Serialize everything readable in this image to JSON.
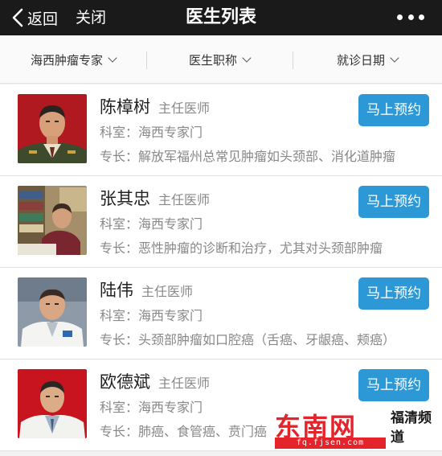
{
  "nav": {
    "back_label": "返回",
    "close_label": "关闭",
    "title": "医生列表"
  },
  "filters": [
    {
      "label": "海西肿瘤专家"
    },
    {
      "label": "医生职称"
    },
    {
      "label": "就诊日期"
    }
  ],
  "doctors": [
    {
      "name": "陈樟树",
      "title": "主任医师",
      "department": "科室：海西专家门",
      "specialty": "专长：解放军福州总常见肿瘤如头颈部、消化道肿瘤",
      "book_label": "马上预约"
    },
    {
      "name": "张其忠",
      "title": "主任医师",
      "department": "科室：海西专家门",
      "specialty": "专长：恶性肿瘤的诊断和治疗，尤其对头颈部肿瘤",
      "book_label": "马上预约"
    },
    {
      "name": "陆伟",
      "title": "主任医师",
      "department": "科室：海西专家门",
      "specialty": "专长：头颈部肿瘤如口腔癌（舌癌、牙龈癌、颊癌）",
      "book_label": "马上预约"
    },
    {
      "name": "欧德斌",
      "title": "主任医师",
      "department": "科室：海西专家门",
      "specialty": "专长：肺癌、食管癌、贲门癌",
      "book_label": "马上预约"
    }
  ],
  "watermark": {
    "brand": "东南网",
    "url": "fq.fjsen.com",
    "channel": "福清频道"
  },
  "colors": {
    "navbar": "#1a1a1a",
    "button": "#2d98d6",
    "watermark_red": "#e4232a"
  }
}
